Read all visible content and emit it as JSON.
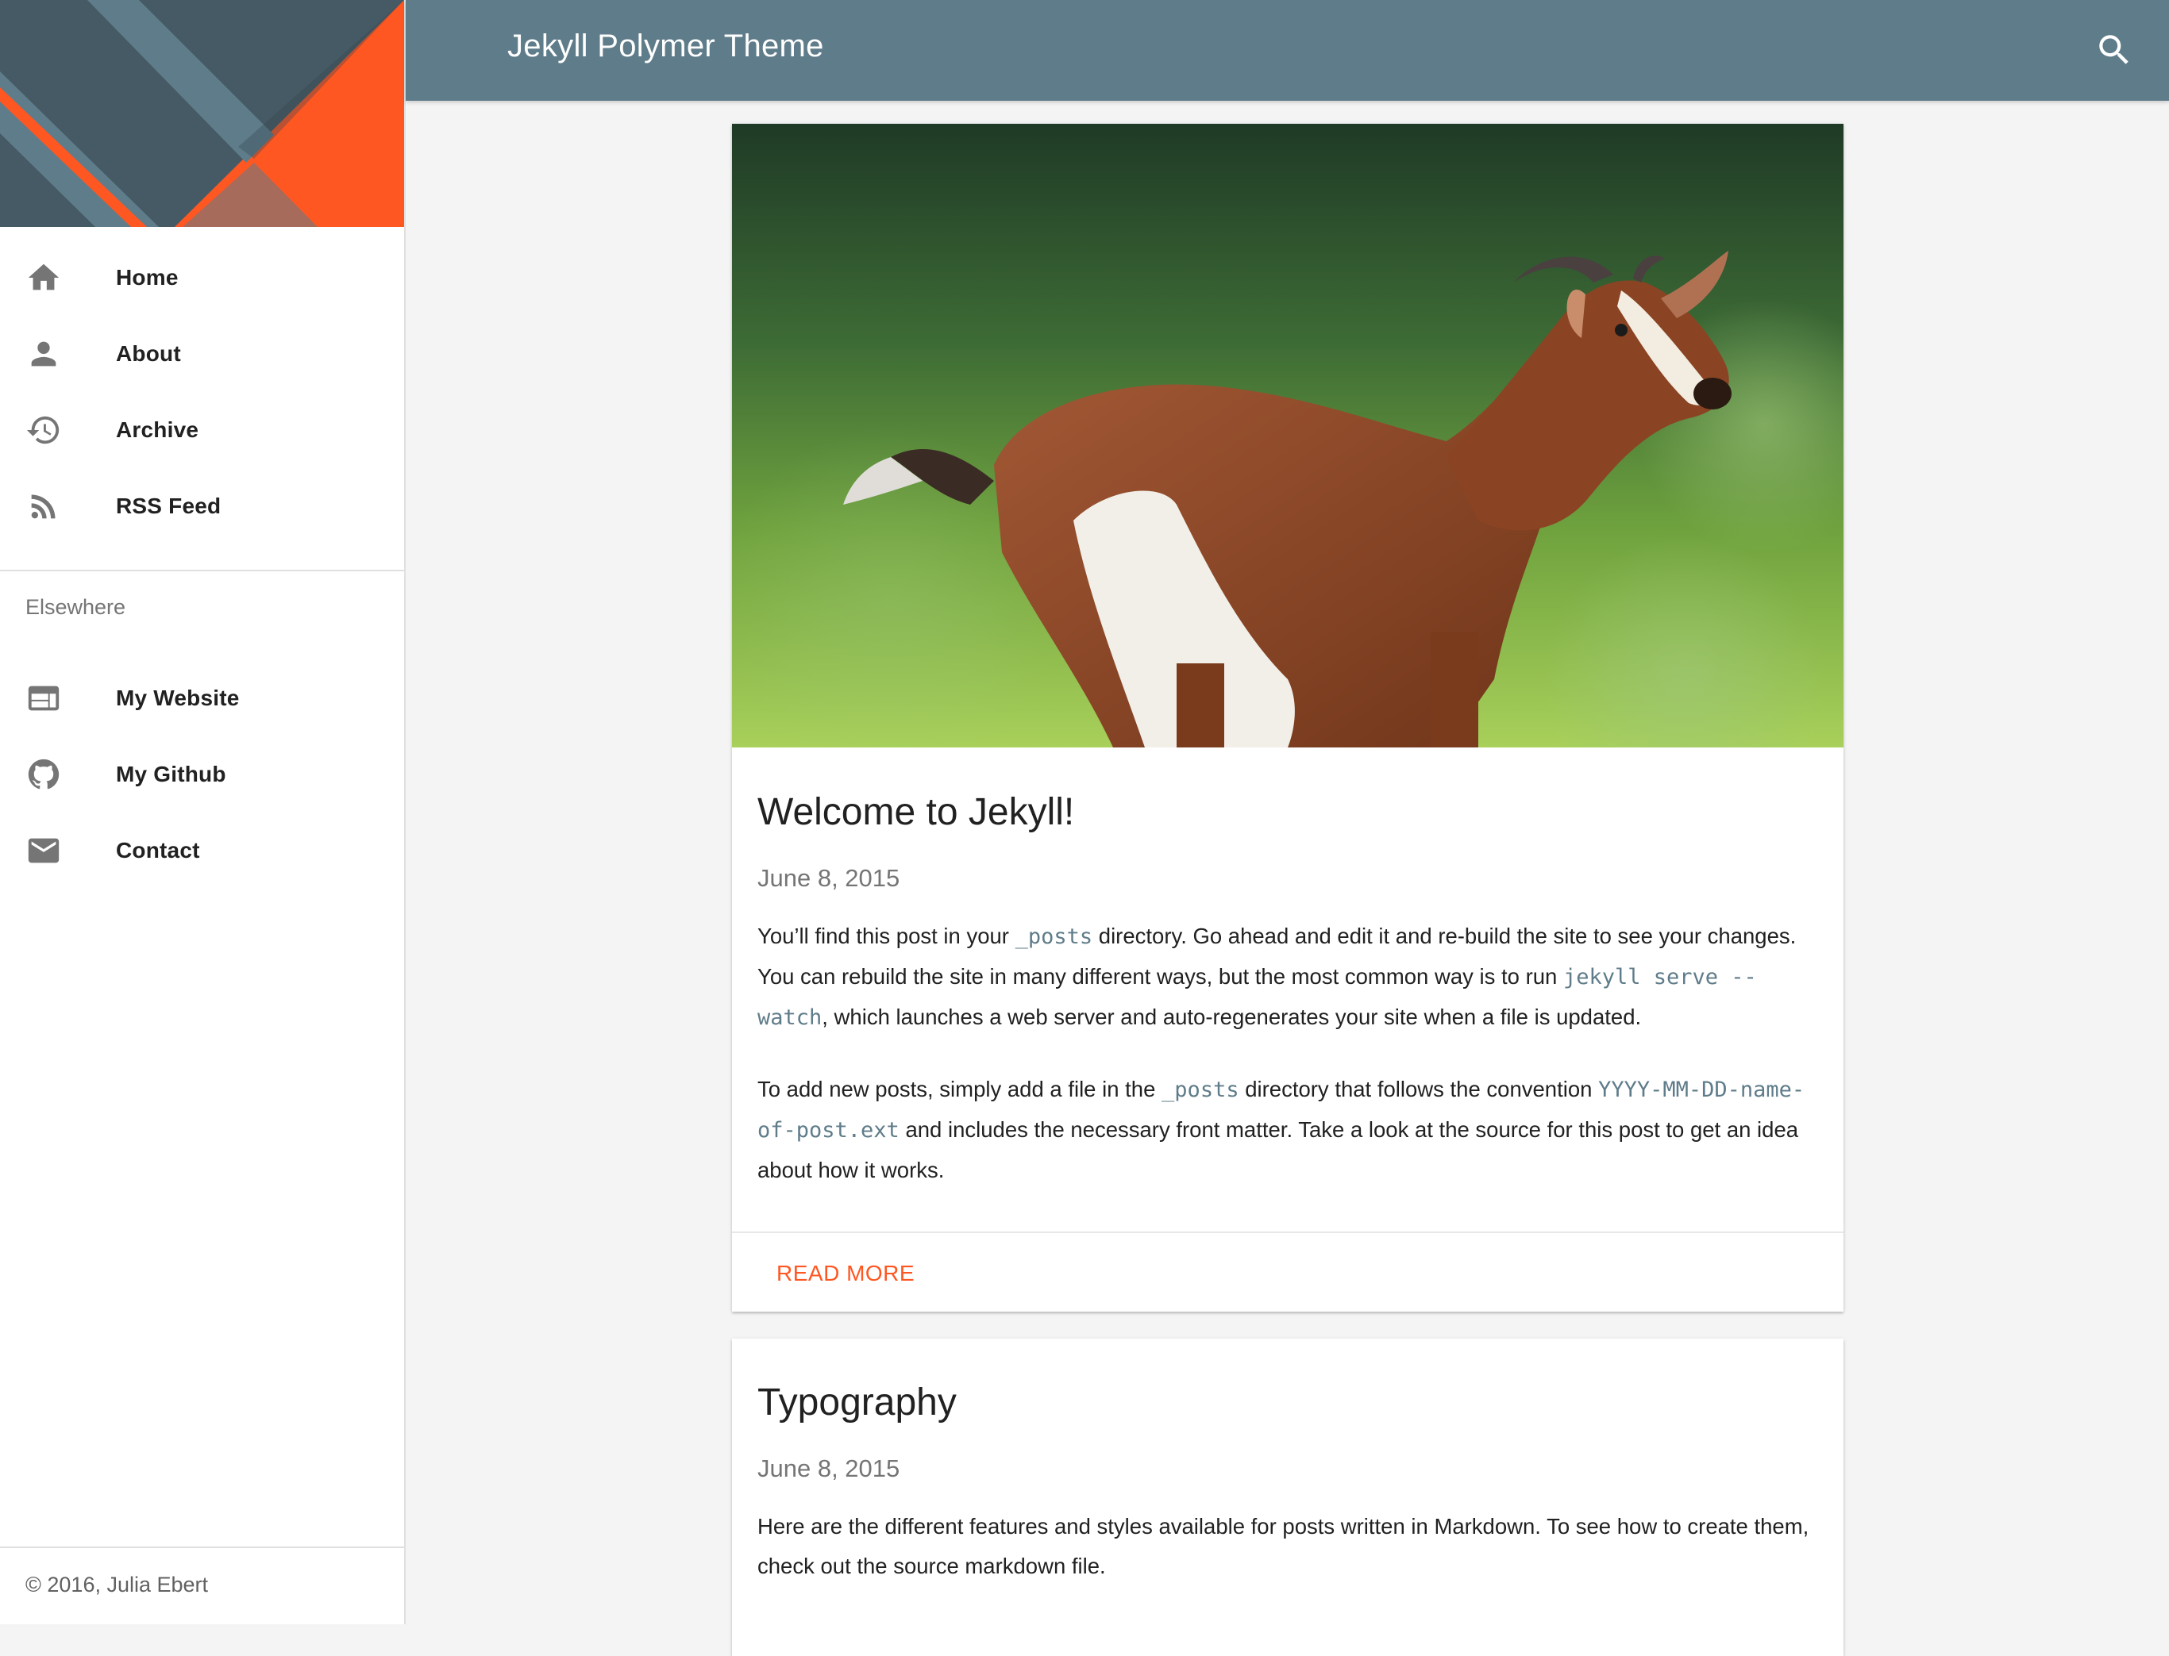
{
  "app": {
    "title": "Jekyll Polymer Theme"
  },
  "colors": {
    "toolbar": "#5f7c8a",
    "accent": "#ff5722",
    "header_dark": "#455a64",
    "header_mid": "#5f7c8a"
  },
  "sidebar": {
    "nav": [
      {
        "label": "Home",
        "icon": "home-icon"
      },
      {
        "label": "About",
        "icon": "person-icon"
      },
      {
        "label": "Archive",
        "icon": "history-icon"
      },
      {
        "label": "RSS Feed",
        "icon": "rss-icon"
      }
    ],
    "subheader": "Elsewhere",
    "elsewhere": [
      {
        "label": "My Website",
        "icon": "web-icon"
      },
      {
        "label": "My Github",
        "icon": "github-icon"
      },
      {
        "label": "Contact",
        "icon": "mail-icon"
      }
    ],
    "footer": "© 2016, Julia Ebert"
  },
  "posts": [
    {
      "title": "Welcome to Jekyll!",
      "date": "June 8, 2015",
      "image": "goat-photo",
      "p1": {
        "t1": "You’ll find this post in your ",
        "c1": "_posts",
        "t2": " directory. Go ahead and edit it and re-build the site to see your changes. You can rebuild the site in many different ways, but the most common way is to run ",
        "c2": "jekyll serve --watch",
        "t3": ", which launches a web server and auto-regenerates your site when a file is updated."
      },
      "p2": {
        "t1": "To add new posts, simply add a file in the ",
        "c1": "_posts",
        "t2": " directory that follows the convention ",
        "c2": "YYYY-MM-DD-name-of-post.ext",
        "t3": " and includes the necessary front matter. Take a look at the source for this post to get an idea about how it works."
      },
      "action": "Read More"
    },
    {
      "title": "Typography",
      "date": "June 8, 2015",
      "p1": "Here are the different features and styles available for posts written in Markdown. To see how to create them, check out the source markdown file."
    }
  ]
}
